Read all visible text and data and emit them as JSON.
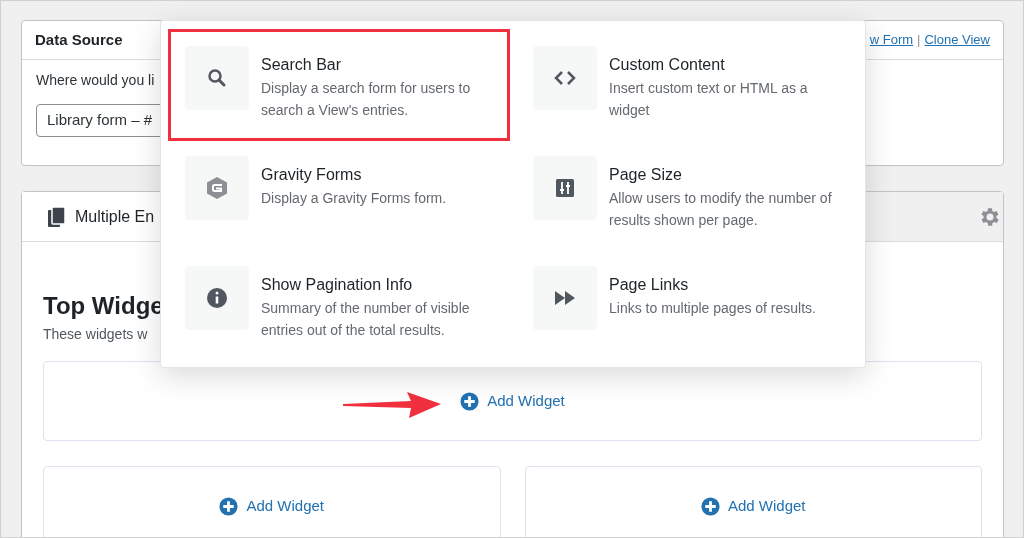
{
  "data_source": {
    "title": "Data Source",
    "links": [
      {
        "label": "w Form"
      },
      {
        "label": "Clone View"
      }
    ],
    "separator": "|",
    "prompt": "Where would you li",
    "select_value": "Library form – #"
  },
  "view_tabs": [
    {
      "label": "Multiple En",
      "selected": true
    }
  ],
  "top_widgets": {
    "title": "Top Widge",
    "subtitle": "These widgets w",
    "add_buttons": [
      {
        "label": "Add Widget"
      },
      {
        "label": "Add Widget"
      },
      {
        "label": "Add Widget"
      }
    ]
  },
  "widget_picker": [
    {
      "kind": "search",
      "title": "Search Bar",
      "description": "Display a search form for users to search a View's entries.",
      "highlighted": true
    },
    {
      "kind": "code",
      "title": "Custom Content",
      "description": "Insert custom text or HTML as a widget",
      "highlighted": false
    },
    {
      "kind": "gravity",
      "title": "Gravity Forms",
      "description": "Display a Gravity Forms form.",
      "highlighted": false
    },
    {
      "kind": "pagesize",
      "title": "Page Size",
      "description": "Allow users to modify the number of results shown per page.",
      "highlighted": false
    },
    {
      "kind": "info",
      "title": "Show Pagination Info",
      "description": "Summary of the number of visible entries out of the total results.",
      "highlighted": false
    },
    {
      "kind": "pagelinks",
      "title": "Page Links",
      "description": "Links to multiple pages of results.",
      "highlighted": false
    }
  ]
}
